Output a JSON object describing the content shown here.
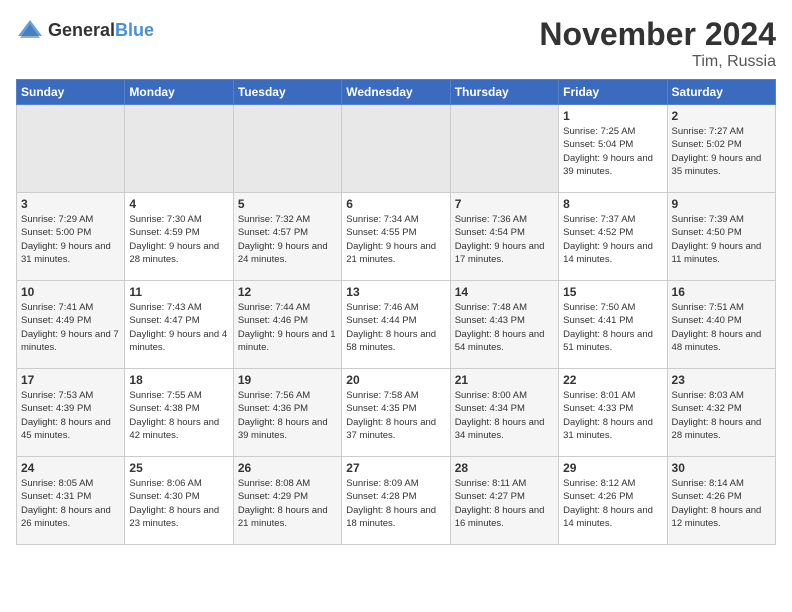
{
  "header": {
    "logo_general": "General",
    "logo_blue": "Blue",
    "month_title": "November 2024",
    "location": "Tim, Russia"
  },
  "weekdays": [
    "Sunday",
    "Monday",
    "Tuesday",
    "Wednesday",
    "Thursday",
    "Friday",
    "Saturday"
  ],
  "weeks": [
    [
      {
        "day": "",
        "info": ""
      },
      {
        "day": "",
        "info": ""
      },
      {
        "day": "",
        "info": ""
      },
      {
        "day": "",
        "info": ""
      },
      {
        "day": "",
        "info": ""
      },
      {
        "day": "1",
        "info": "Sunrise: 7:25 AM\nSunset: 5:04 PM\nDaylight: 9 hours and 39 minutes."
      },
      {
        "day": "2",
        "info": "Sunrise: 7:27 AM\nSunset: 5:02 PM\nDaylight: 9 hours and 35 minutes."
      }
    ],
    [
      {
        "day": "3",
        "info": "Sunrise: 7:29 AM\nSunset: 5:00 PM\nDaylight: 9 hours and 31 minutes."
      },
      {
        "day": "4",
        "info": "Sunrise: 7:30 AM\nSunset: 4:59 PM\nDaylight: 9 hours and 28 minutes."
      },
      {
        "day": "5",
        "info": "Sunrise: 7:32 AM\nSunset: 4:57 PM\nDaylight: 9 hours and 24 minutes."
      },
      {
        "day": "6",
        "info": "Sunrise: 7:34 AM\nSunset: 4:55 PM\nDaylight: 9 hours and 21 minutes."
      },
      {
        "day": "7",
        "info": "Sunrise: 7:36 AM\nSunset: 4:54 PM\nDaylight: 9 hours and 17 minutes."
      },
      {
        "day": "8",
        "info": "Sunrise: 7:37 AM\nSunset: 4:52 PM\nDaylight: 9 hours and 14 minutes."
      },
      {
        "day": "9",
        "info": "Sunrise: 7:39 AM\nSunset: 4:50 PM\nDaylight: 9 hours and 11 minutes."
      }
    ],
    [
      {
        "day": "10",
        "info": "Sunrise: 7:41 AM\nSunset: 4:49 PM\nDaylight: 9 hours and 7 minutes."
      },
      {
        "day": "11",
        "info": "Sunrise: 7:43 AM\nSunset: 4:47 PM\nDaylight: 9 hours and 4 minutes."
      },
      {
        "day": "12",
        "info": "Sunrise: 7:44 AM\nSunset: 4:46 PM\nDaylight: 9 hours and 1 minute."
      },
      {
        "day": "13",
        "info": "Sunrise: 7:46 AM\nSunset: 4:44 PM\nDaylight: 8 hours and 58 minutes."
      },
      {
        "day": "14",
        "info": "Sunrise: 7:48 AM\nSunset: 4:43 PM\nDaylight: 8 hours and 54 minutes."
      },
      {
        "day": "15",
        "info": "Sunrise: 7:50 AM\nSunset: 4:41 PM\nDaylight: 8 hours and 51 minutes."
      },
      {
        "day": "16",
        "info": "Sunrise: 7:51 AM\nSunset: 4:40 PM\nDaylight: 8 hours and 48 minutes."
      }
    ],
    [
      {
        "day": "17",
        "info": "Sunrise: 7:53 AM\nSunset: 4:39 PM\nDaylight: 8 hours and 45 minutes."
      },
      {
        "day": "18",
        "info": "Sunrise: 7:55 AM\nSunset: 4:38 PM\nDaylight: 8 hours and 42 minutes."
      },
      {
        "day": "19",
        "info": "Sunrise: 7:56 AM\nSunset: 4:36 PM\nDaylight: 8 hours and 39 minutes."
      },
      {
        "day": "20",
        "info": "Sunrise: 7:58 AM\nSunset: 4:35 PM\nDaylight: 8 hours and 37 minutes."
      },
      {
        "day": "21",
        "info": "Sunrise: 8:00 AM\nSunset: 4:34 PM\nDaylight: 8 hours and 34 minutes."
      },
      {
        "day": "22",
        "info": "Sunrise: 8:01 AM\nSunset: 4:33 PM\nDaylight: 8 hours and 31 minutes."
      },
      {
        "day": "23",
        "info": "Sunrise: 8:03 AM\nSunset: 4:32 PM\nDaylight: 8 hours and 28 minutes."
      }
    ],
    [
      {
        "day": "24",
        "info": "Sunrise: 8:05 AM\nSunset: 4:31 PM\nDaylight: 8 hours and 26 minutes."
      },
      {
        "day": "25",
        "info": "Sunrise: 8:06 AM\nSunset: 4:30 PM\nDaylight: 8 hours and 23 minutes."
      },
      {
        "day": "26",
        "info": "Sunrise: 8:08 AM\nSunset: 4:29 PM\nDaylight: 8 hours and 21 minutes."
      },
      {
        "day": "27",
        "info": "Sunrise: 8:09 AM\nSunset: 4:28 PM\nDaylight: 8 hours and 18 minutes."
      },
      {
        "day": "28",
        "info": "Sunrise: 8:11 AM\nSunset: 4:27 PM\nDaylight: 8 hours and 16 minutes."
      },
      {
        "day": "29",
        "info": "Sunrise: 8:12 AM\nSunset: 4:26 PM\nDaylight: 8 hours and 14 minutes."
      },
      {
        "day": "30",
        "info": "Sunrise: 8:14 AM\nSunset: 4:26 PM\nDaylight: 8 hours and 12 minutes."
      }
    ]
  ]
}
